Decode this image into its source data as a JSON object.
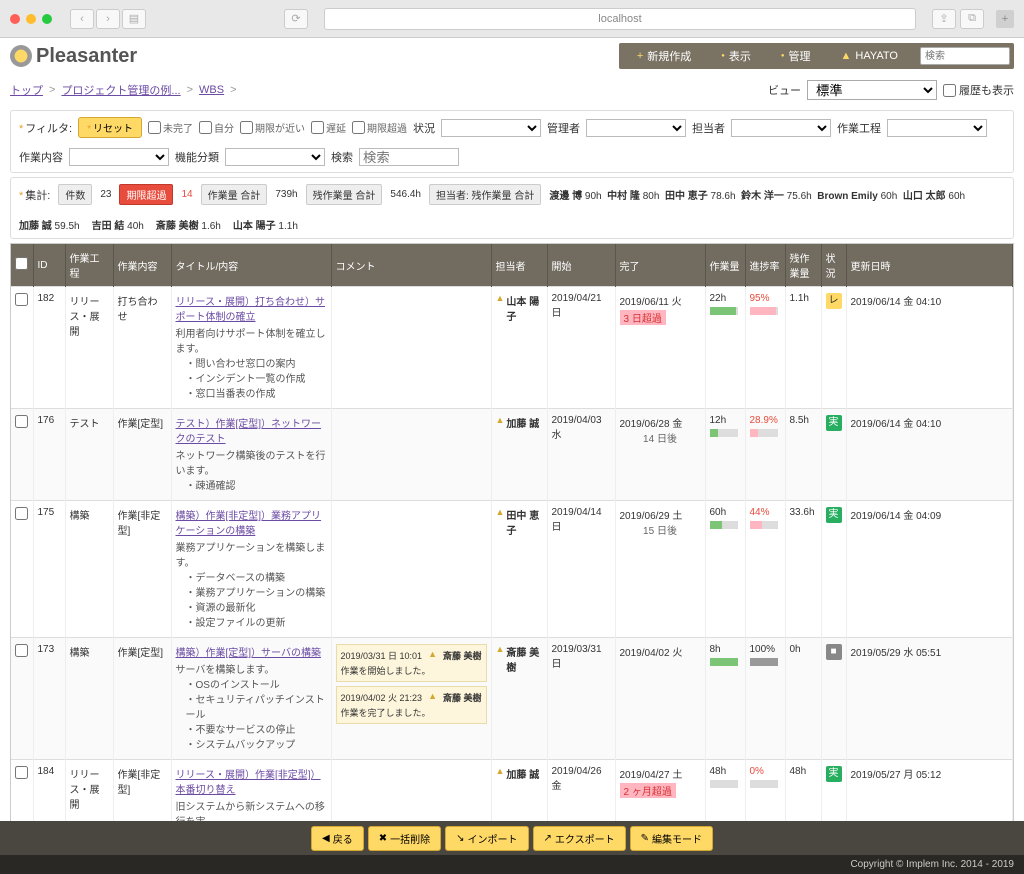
{
  "browser": {
    "url": "localhost"
  },
  "logo": "Pleasanter",
  "topmenu": {
    "new": "新規作成",
    "view": "表示",
    "manage": "管理",
    "user": "HAYATO",
    "search_ph": "検索"
  },
  "breadcrumb": {
    "top": "トップ",
    "proj": "プロジェクト管理の例...",
    "wbs": "WBS"
  },
  "viewctrl": {
    "label": "ビュー",
    "selected": "標準",
    "history": "履歴も表示"
  },
  "filter": {
    "label": "フィルタ:",
    "reset": "リセット",
    "incomplete": "未完了",
    "own": "自分",
    "near": "期限が近い",
    "delay": "遅延",
    "overdue": "期限超過",
    "status": "状況",
    "manager": "管理者",
    "assignee": "担当者",
    "process": "作業工程",
    "content": "作業内容",
    "category": "機能分類",
    "search": "検索",
    "search_ph": "検索"
  },
  "agg": {
    "label": "集計:",
    "count_l": "件数",
    "count": "23",
    "overdue_l": "期限超過",
    "overdue": "14",
    "work_l": "作業量 合計",
    "work": "739h",
    "remain_l": "残作業量 合計",
    "remain": "546.4h",
    "assign_l": "担当者: 残作業量 合計",
    "people": [
      {
        "n": "渡邊 博",
        "v": "90h"
      },
      {
        "n": "中村 隆",
        "v": "80h"
      },
      {
        "n": "田中 恵子",
        "v": "78.6h"
      },
      {
        "n": "鈴木 洋一",
        "v": "75.6h"
      },
      {
        "n": "Brown Emily",
        "v": "60h"
      },
      {
        "n": "山口 太郎",
        "v": "60h"
      }
    ],
    "row2": [
      {
        "n": "加藤 誠",
        "v": "59.5h"
      },
      {
        "n": "吉田 結",
        "v": "40h"
      },
      {
        "n": "斎藤 美樹",
        "v": "1.6h"
      },
      {
        "n": "山本 陽子",
        "v": "1.1h"
      }
    ]
  },
  "cols": {
    "id": "ID",
    "proc": "作業工程",
    "cont": "作業内容",
    "title": "タイトル/内容",
    "comm": "コメント",
    "assign": "担当者",
    "start": "開始",
    "end": "完了",
    "work": "作業量",
    "prog": "進捗率",
    "rem": "残作業量",
    "stat": "状況",
    "upd": "更新日時"
  },
  "rows": [
    {
      "id": "182",
      "proc": "リリース・展開",
      "cont": "打ち合わせ",
      "title": "リリース・展開）打ち合わせ）サポート体制の確立",
      "desc": "利用者向けサポート体制を確立します。",
      "bullets": [
        "問い合わせ窓口の案内",
        "インシデント一覧の作成",
        "窓口当番表の作成"
      ],
      "assign": "山本 陽子",
      "start": "2019/04/21 日",
      "end": "2019/06/11 火",
      "end_extra": "3 日超過",
      "end_over": true,
      "work": "22h",
      "prog": "95%",
      "prog_red": true,
      "rem": "1.1h",
      "stat": "レ",
      "stat_cls": "yellow",
      "upd": "2019/06/14 金 04:10"
    },
    {
      "id": "176",
      "proc": "テスト",
      "cont": "作業[定型]",
      "title": "テスト）作業[定型]）ネットワークのテスト",
      "desc": "ネットワーク構築後のテストを行います。",
      "bullets": [
        "疎通確認"
      ],
      "assign": "加藤 誠",
      "start": "2019/04/03 水",
      "end": "2019/06/28 金",
      "end_extra": "14 日後",
      "work": "12h",
      "prog": "28.9%",
      "prog_red": true,
      "rem": "8.5h",
      "stat": "実",
      "stat_cls": "green",
      "upd": "2019/06/14 金 04:10"
    },
    {
      "id": "175",
      "proc": "構築",
      "cont": "作業[非定型]",
      "title": "構築）作業[非定型]）業務アプリケーションの構築",
      "desc": "業務アプリケーションを構築します。",
      "bullets": [
        "データベースの構築",
        "業務アプリケーションの構築",
        "資源の最新化",
        "設定ファイルの更新"
      ],
      "assign": "田中 恵子",
      "start": "2019/04/14 日",
      "end": "2019/06/29 土",
      "end_extra": "15 日後",
      "work": "60h",
      "prog": "44%",
      "prog_red": true,
      "rem": "33.6h",
      "stat": "実",
      "stat_cls": "green",
      "upd": "2019/06/14 金 04:09"
    },
    {
      "id": "173",
      "proc": "構築",
      "cont": "作業[定型]",
      "title": "構築）作業[定型]）サーバの構築",
      "desc": "サーバを構築します。",
      "bullets": [
        "OSのインストール",
        "セキュリティパッチインストール",
        "不要なサービスの停止",
        "システムバックアップ"
      ],
      "comments": [
        {
          "date": "2019/03/31 日 10:01",
          "user": "斎藤 美樹",
          "text": "作業を開始しました。"
        },
        {
          "date": "2019/04/02 火 21:23",
          "user": "斎藤 美樹",
          "text": "作業を完了しました。"
        }
      ],
      "assign": "斎藤 美樹",
      "start": "2019/03/31 日",
      "end": "2019/04/02 火",
      "work": "8h",
      "prog": "100%",
      "rem": "0h",
      "stat": "■",
      "stat_cls": "gray",
      "upd": "2019/05/29 水 05:51"
    },
    {
      "id": "184",
      "proc": "リリース・展開",
      "cont": "作業[非定型]",
      "title": "リリース・展開）作業[非定型]）本番切り替え",
      "desc": "旧システムから新システムへの移行を実...",
      "bullets": [],
      "assign": "加藤 誠",
      "start": "2019/04/26 金",
      "end": "2019/04/27 土",
      "end_extra": "2 ヶ月超過",
      "end_over": true,
      "work": "48h",
      "prog": "0%",
      "prog_red": true,
      "rem": "48h",
      "stat": "実",
      "stat_cls": "green",
      "upd": "2019/05/27 月 05:12"
    }
  ],
  "bottombar": {
    "back": "戻る",
    "delall": "一括削除",
    "import": "インポート",
    "export": "エクスポート",
    "edit": "編集モード"
  },
  "footer": "Copyright © Implem Inc. 2014 - 2019"
}
